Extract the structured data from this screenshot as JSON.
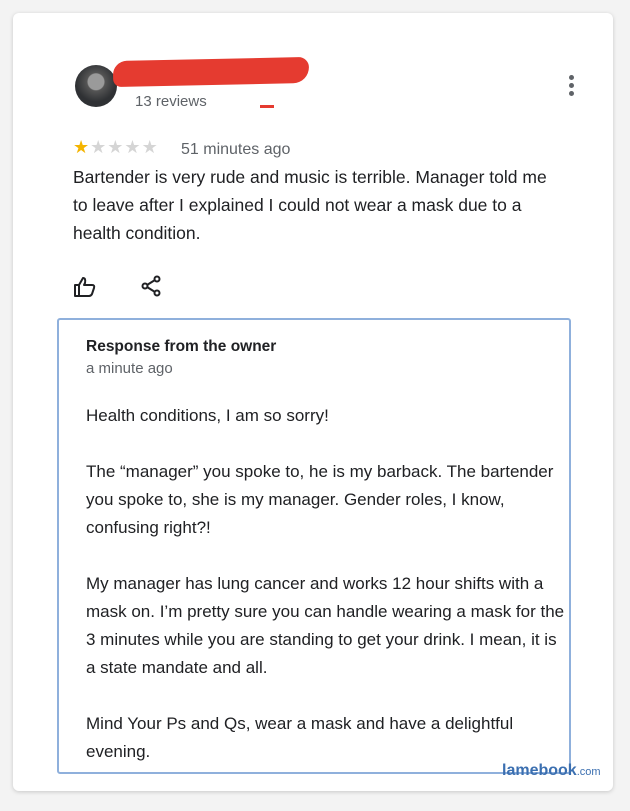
{
  "review": {
    "reviews_count": "13 reviews",
    "rating": 1,
    "rating_max": 5,
    "time": "51 minutes ago",
    "text": "Bartender is very rude and music is terrible. Manager told me to leave after I explained I could not wear a mask due to a health condition."
  },
  "owner_response": {
    "title": "Response from the owner",
    "time": "a minute ago",
    "paragraphs": [
      "Health conditions, I am so sorry!",
      "The “manager” you spoke to, he is my barback. The bartender you spoke to, she is my manager. Gender roles, I know, confusing right?!",
      "My manager has lung cancer and works 12 hour shifts with a mask on. I’m pretty sure you can handle wearing a mask for the 3 minutes while you are standing to get your drink. I mean, it is a state mandate and all.",
      "Mind Your Ps and Qs, wear a mask and have a delightful evening."
    ]
  },
  "watermark": {
    "brand": "lamebook",
    "domain": ".com"
  },
  "colors": {
    "star_filled": "#f4b400",
    "star_empty": "#d5d5d5",
    "box_border": "#8fb0dc",
    "redaction": "#e53b30"
  },
  "icons": {
    "like": "thumb-up-icon",
    "share": "share-icon",
    "more": "more-vert-icon"
  }
}
